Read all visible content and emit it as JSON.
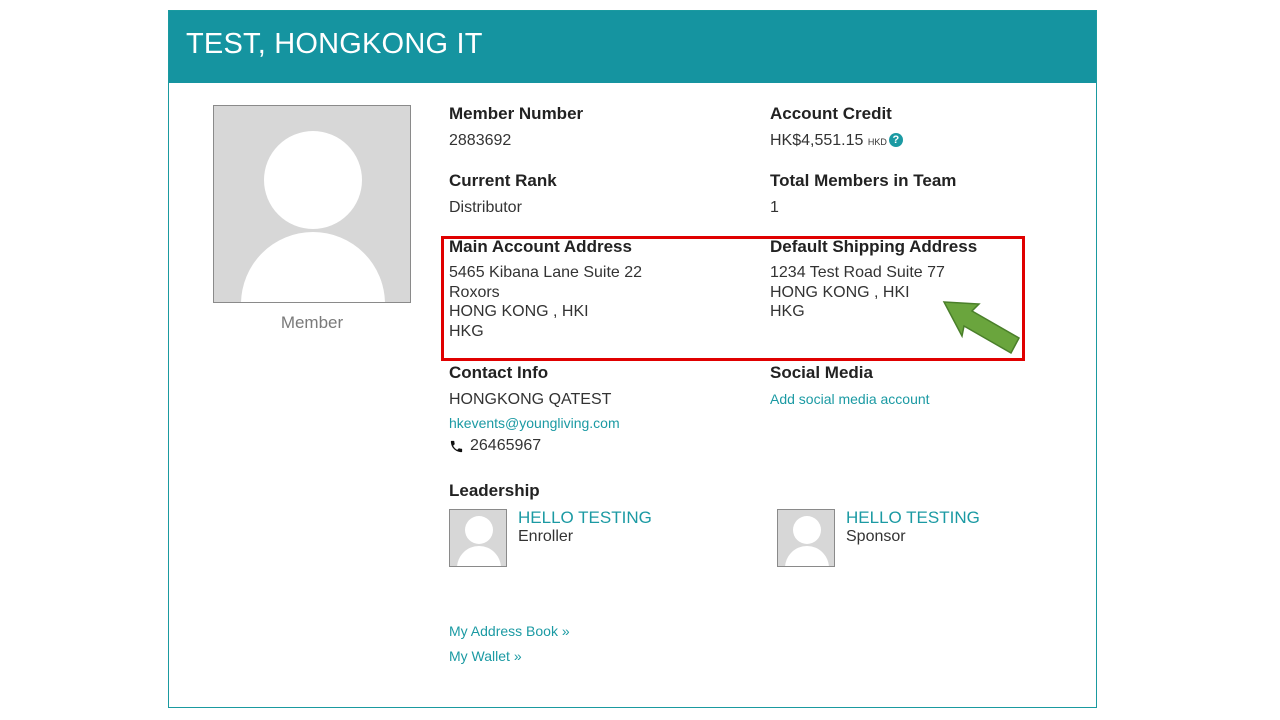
{
  "header": {
    "title": "TEST, HONGKONG IT"
  },
  "profile": {
    "caption": "Member"
  },
  "member_number": {
    "label": "Member Number",
    "value": "2883692"
  },
  "account_credit": {
    "label": "Account Credit",
    "value": "HK$4,551.15",
    "currency": "HKD",
    "help_glyph": "?"
  },
  "current_rank": {
    "label": "Current Rank",
    "value": "Distributor"
  },
  "team": {
    "label": "Total Members in Team",
    "value": "1"
  },
  "main_address": {
    "label": "Main Account Address",
    "lines": [
      "5465 Kibana Lane Suite 22",
      "Roxors",
      "HONG KONG , HKI",
      "HKG"
    ]
  },
  "shipping_address": {
    "label": "Default Shipping Address",
    "lines": [
      "1234 Test Road Suite 77",
      "HONG KONG , HKI",
      "HKG"
    ]
  },
  "contact": {
    "label": "Contact Info",
    "name": "HONGKONG QATEST",
    "email": "hkevents@youngliving.com",
    "phone": "26465967"
  },
  "social": {
    "label": "Social Media",
    "link": "Add social media account"
  },
  "leadership": {
    "label": "Leadership",
    "enroller": {
      "name": "HELLO TESTING",
      "role": "Enroller"
    },
    "sponsor": {
      "name": "HELLO TESTING",
      "role": "Sponsor"
    }
  },
  "links": {
    "address_book": "My Address Book »",
    "wallet": "My Wallet »"
  },
  "colors": {
    "header": "#1594a0",
    "link": "#1b9aa3",
    "highlight": "#e00000",
    "arrow": "#6aa53d"
  }
}
